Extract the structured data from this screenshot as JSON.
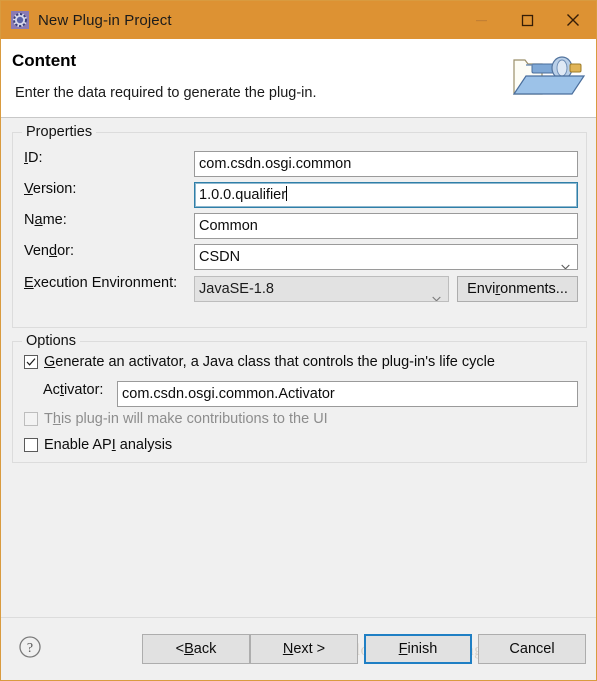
{
  "window": {
    "title": "New Plug-in Project",
    "icon": "eclipse-gear-icon",
    "accent_color": "#dd9233",
    "controls": {
      "minimize": "minimize-icon",
      "maximize": "maximize-icon",
      "close": "close-icon"
    }
  },
  "header": {
    "title": "Content",
    "description": "Enter the data required to generate the plug-in.",
    "banner_icon": "plugin-folder-icon"
  },
  "properties": {
    "group_label": "Properties",
    "fields": [
      {
        "label_prefix": "",
        "label_mnemonic": "I",
        "label_suffix": "D:",
        "name": "id",
        "value": "com.csdn.osgi.common",
        "control": "textbox",
        "focused": false
      },
      {
        "label_prefix": "",
        "label_mnemonic": "V",
        "label_suffix": "ersion:",
        "name": "version",
        "value": "1.0.0.qualifier",
        "control": "textbox",
        "focused": true
      },
      {
        "label_prefix": "N",
        "label_mnemonic": "a",
        "label_suffix": "me:",
        "name": "name",
        "value": "Common",
        "control": "textbox",
        "focused": false
      },
      {
        "label_prefix": "Ven",
        "label_mnemonic": "d",
        "label_suffix": "or:",
        "name": "vendor",
        "value": "CSDN",
        "control": "combo",
        "focused": false
      },
      {
        "label_prefix": "",
        "label_mnemonic": "E",
        "label_suffix": "xecution Environment:",
        "name": "execution-environment",
        "value": "JavaSE-1.8",
        "control": "combo-readonly",
        "focused": false
      }
    ],
    "environments_button": {
      "prefix": "Envi",
      "mnemonic": "r",
      "suffix": "onments..."
    }
  },
  "options": {
    "group_label": "Options",
    "generate_activator": {
      "prefix": "",
      "mnemonic": "G",
      "suffix": "enerate an activator, a Java class that controls the plug-in's life cycle",
      "checked": true,
      "enabled": true
    },
    "activator_label": {
      "prefix": "Ac",
      "mnemonic": "t",
      "suffix": "ivator:"
    },
    "activator_value": "com.csdn.osgi.common.Activator",
    "ui_contributions": {
      "prefix": "T",
      "mnemonic": "h",
      "suffix": "is plug-in will make contributions to the UI",
      "checked": false,
      "enabled": false
    },
    "api_analysis": {
      "prefix": "Enable AP",
      "mnemonic": "I",
      "suffix": " analysis",
      "checked": false,
      "enabled": true
    }
  },
  "footer": {
    "help_icon": "help-question-icon",
    "buttons": [
      {
        "name": "back",
        "prefix": "< ",
        "mnemonic": "B",
        "suffix": "ack",
        "default": false
      },
      {
        "name": "next",
        "prefix": "",
        "mnemonic": "N",
        "suffix": "ext >",
        "default": false
      },
      {
        "name": "finish",
        "prefix": "",
        "mnemonic": "F",
        "suffix": "inish",
        "default": true
      },
      {
        "name": "cancel",
        "prefix": "Cancel",
        "mnemonic": "",
        "suffix": "",
        "default": false
      }
    ],
    "watermark": "http://blog.csdn.net/kongbo_j"
  }
}
